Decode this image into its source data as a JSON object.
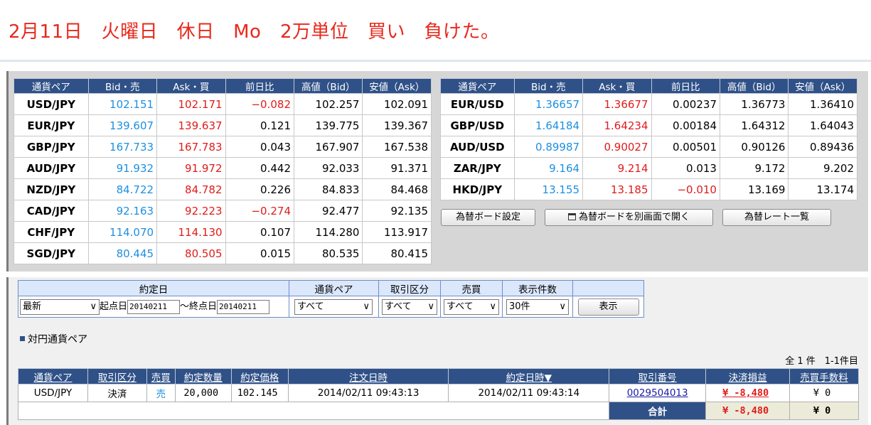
{
  "title": "2月11日　火曜日　休日　Mo　2万単位　買い　負けた。",
  "rate_headers": [
    "通貨ペア",
    "Bid・売",
    "Ask・買",
    "前日比",
    "高値（Bid）",
    "安値（Ask）"
  ],
  "left_rates": [
    {
      "pair": "USD/JPY",
      "bid": "102.151",
      "ask": "102.171",
      "change": "−0.082",
      "high": "102.257",
      "low": "102.091",
      "neg": true
    },
    {
      "pair": "EUR/JPY",
      "bid": "139.607",
      "ask": "139.637",
      "change": "0.121",
      "high": "139.775",
      "low": "139.367",
      "neg": false
    },
    {
      "pair": "GBP/JPY",
      "bid": "167.733",
      "ask": "167.783",
      "change": "0.043",
      "high": "167.907",
      "low": "167.538",
      "neg": false
    },
    {
      "pair": "AUD/JPY",
      "bid": "91.932",
      "ask": "91.972",
      "change": "0.442",
      "high": "92.033",
      "low": "91.371",
      "neg": false
    },
    {
      "pair": "NZD/JPY",
      "bid": "84.722",
      "ask": "84.782",
      "change": "0.226",
      "high": "84.833",
      "low": "84.468",
      "neg": false
    },
    {
      "pair": "CAD/JPY",
      "bid": "92.163",
      "ask": "92.223",
      "change": "−0.274",
      "high": "92.477",
      "low": "92.135",
      "neg": true
    },
    {
      "pair": "CHF/JPY",
      "bid": "114.070",
      "ask": "114.130",
      "change": "0.107",
      "high": "114.280",
      "low": "113.917",
      "neg": false
    },
    {
      "pair": "SGD/JPY",
      "bid": "80.445",
      "ask": "80.505",
      "change": "0.015",
      "high": "80.535",
      "low": "80.415",
      "neg": false
    }
  ],
  "right_rates": [
    {
      "pair": "EUR/USD",
      "bid": "1.36657",
      "ask": "1.36677",
      "change": "0.00237",
      "high": "1.36773",
      "low": "1.36410",
      "neg": false
    },
    {
      "pair": "GBP/USD",
      "bid": "1.64184",
      "ask": "1.64234",
      "change": "0.00184",
      "high": "1.64312",
      "low": "1.64043",
      "neg": false
    },
    {
      "pair": "AUD/USD",
      "bid": "0.89987",
      "ask": "0.90027",
      "change": "0.00501",
      "high": "0.90126",
      "low": "0.89436",
      "neg": false
    },
    {
      "pair": "ZAR/JPY",
      "bid": "9.164",
      "ask": "9.214",
      "change": "0.013",
      "high": "9.172",
      "low": "9.202",
      "neg": false
    },
    {
      "pair": "HKD/JPY",
      "bid": "13.155",
      "ask": "13.185",
      "change": "−0.010",
      "high": "13.169",
      "low": "13.174",
      "neg": true
    }
  ],
  "buttons": {
    "board_settings": "為替ボード設定",
    "open_board": "為替ボードを別画面で開く",
    "rate_list": "為替レート一覧"
  },
  "filter": {
    "headers": {
      "date": "約定日",
      "pair": "通貨ペア",
      "type": "取引区分",
      "side": "売買",
      "count": "表示件数"
    },
    "date_select": "最新",
    "start_label": "起点日",
    "start_value": "20140211",
    "tilde": "～",
    "end_label": "終点日",
    "end_value": "20140211",
    "pair_select": "すべて",
    "type_select": "すべて",
    "side_select": "すべて",
    "count_select": "30件",
    "show_button": "表示"
  },
  "section_label": "対円通貨ペア",
  "result_count": "全 1 件　1-1件目",
  "results": {
    "headers": [
      "通貨ペア",
      "取引区分",
      "売買",
      "約定数量",
      "約定価格",
      "注文日時",
      "約定日時▼",
      "取引番号",
      "決済損益",
      "売買手数料"
    ],
    "row": {
      "pair": "USD/JPY",
      "type": "決済",
      "side": "売",
      "quantity": "20,000",
      "price": "102.145",
      "order_time": "2014/02/11 09:43:13",
      "exec_time": "2014/02/11 09:43:14",
      "trade_no": "0029504013",
      "pnl": "¥ -8,480",
      "fee": "¥ 0"
    },
    "total_label": "合計",
    "total_pnl": "¥ -8,480",
    "total_fee": "¥ 0"
  }
}
